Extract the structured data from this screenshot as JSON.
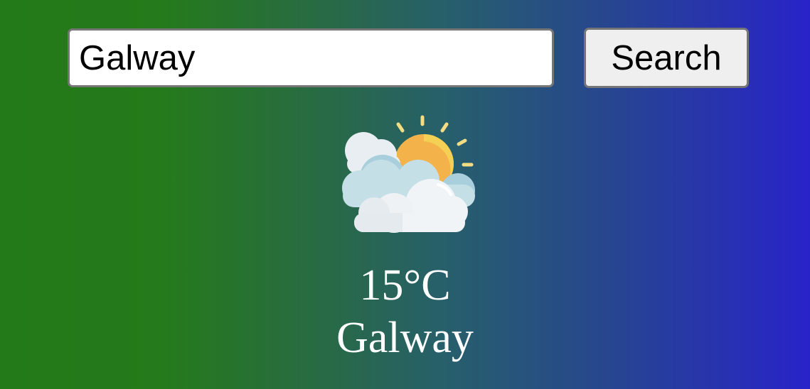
{
  "search": {
    "value": "Galway",
    "button_label": "Search"
  },
  "weather": {
    "icon": "partly-cloudy-icon",
    "temperature": "15°C",
    "city": "Galway"
  },
  "colors": {
    "gradient_start": "#237a18",
    "gradient_end": "#2823c9",
    "text": "#ffffff"
  }
}
